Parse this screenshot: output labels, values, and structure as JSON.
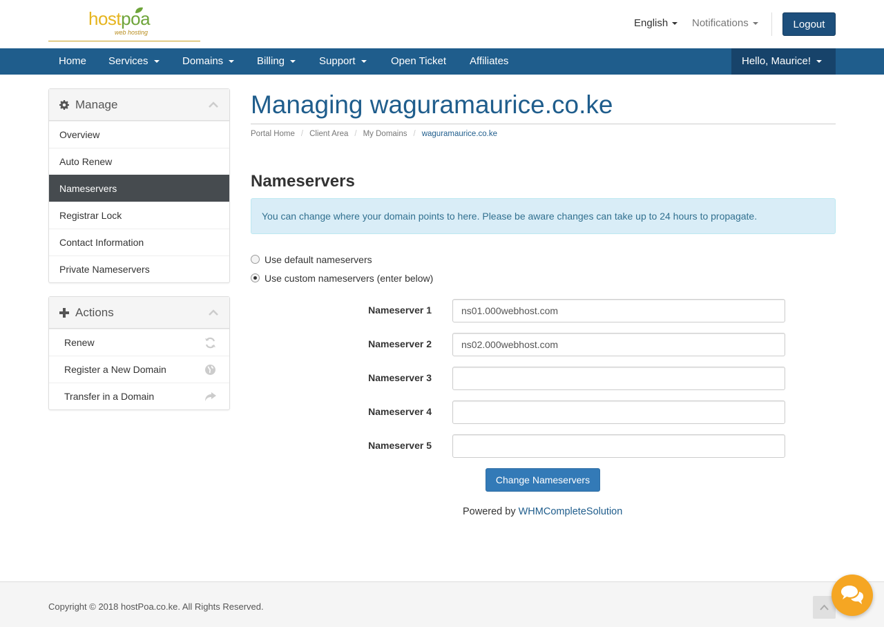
{
  "brand": {
    "logo_host": "host",
    "logo_poa": "poa",
    "logo_sub": "web hosting"
  },
  "header": {
    "language": "English",
    "notifications": "Notifications",
    "logout": "Logout"
  },
  "nav": {
    "items": [
      {
        "label": "Home"
      },
      {
        "label": "Services"
      },
      {
        "label": "Domains"
      },
      {
        "label": "Billing"
      },
      {
        "label": "Support"
      },
      {
        "label": "Open Ticket"
      },
      {
        "label": "Affiliates"
      }
    ],
    "user_greeting": "Hello, Maurice!"
  },
  "manage_panel": {
    "title": "Manage",
    "items": [
      {
        "label": "Overview"
      },
      {
        "label": "Auto Renew"
      },
      {
        "label": "Nameservers",
        "active": true
      },
      {
        "label": "Registrar Lock"
      },
      {
        "label": "Contact Information"
      },
      {
        "label": "Private Nameservers"
      }
    ]
  },
  "actions_panel": {
    "title": "Actions",
    "items": [
      {
        "label": "Renew",
        "icon": "refresh-icon"
      },
      {
        "label": "Register a New Domain",
        "icon": "globe-icon"
      },
      {
        "label": "Transfer in a Domain",
        "icon": "share-icon"
      }
    ]
  },
  "main": {
    "title": "Managing waguramaurice.co.ke",
    "breadcrumb": [
      "Portal Home",
      "Client Area",
      "My Domains",
      "waguramaurice.co.ke"
    ],
    "section_title": "Nameservers",
    "alert": "You can change where your domain points to here. Please be aware changes can take up to 24 hours to propagate.",
    "radio_default": "Use default nameservers",
    "radio_custom": "Use custom nameservers (enter below)",
    "selected_option": "custom",
    "nameservers": [
      {
        "label": "Nameserver 1",
        "value": "ns01.000webhost.com"
      },
      {
        "label": "Nameserver 2",
        "value": "ns02.000webhost.com"
      },
      {
        "label": "Nameserver 3",
        "value": ""
      },
      {
        "label": "Nameserver 4",
        "value": ""
      },
      {
        "label": "Nameserver 5",
        "value": ""
      }
    ],
    "submit": "Change Nameservers",
    "powered_by": "Powered by",
    "powered_link": "WHMCompleteSolution"
  },
  "footer": {
    "copyright": "Copyright © 2018 hostPoa.co.ke. All Rights Reserved."
  },
  "colors": {
    "brand_blue": "#1f5d8c",
    "active_item": "#464b4f",
    "chat_orange": "#f5a623"
  }
}
